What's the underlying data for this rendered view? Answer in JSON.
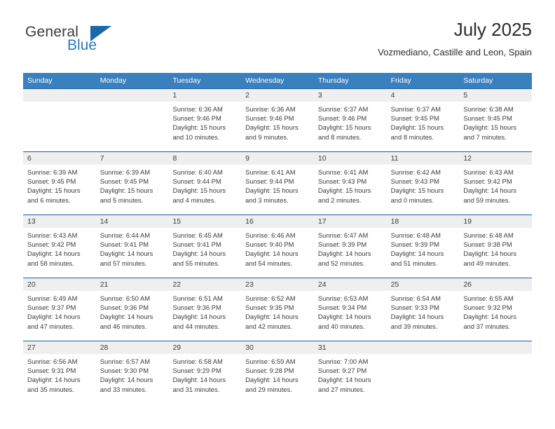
{
  "brand": {
    "name_part1": "General",
    "name_part2": "Blue",
    "triangle_color": "#1769a8",
    "blue_color": "#2a7ac0"
  },
  "header": {
    "month_title": "July 2025",
    "location": "Vozmediano, Castille and Leon, Spain",
    "header_bg": "#3a7fbe",
    "row_divider": "#1c5f9e",
    "daynum_bg": "#efeff0"
  },
  "weekdays": [
    "Sunday",
    "Monday",
    "Tuesday",
    "Wednesday",
    "Thursday",
    "Friday",
    "Saturday"
  ],
  "weeks": [
    [
      {
        "day": "",
        "sunrise": "",
        "sunset": "",
        "daylight1": "",
        "daylight2": ""
      },
      {
        "day": "",
        "sunrise": "",
        "sunset": "",
        "daylight1": "",
        "daylight2": ""
      },
      {
        "day": "1",
        "sunrise": "Sunrise: 6:36 AM",
        "sunset": "Sunset: 9:46 PM",
        "daylight1": "Daylight: 15 hours",
        "daylight2": "and 10 minutes."
      },
      {
        "day": "2",
        "sunrise": "Sunrise: 6:36 AM",
        "sunset": "Sunset: 9:46 PM",
        "daylight1": "Daylight: 15 hours",
        "daylight2": "and 9 minutes."
      },
      {
        "day": "3",
        "sunrise": "Sunrise: 6:37 AM",
        "sunset": "Sunset: 9:46 PM",
        "daylight1": "Daylight: 15 hours",
        "daylight2": "and 8 minutes."
      },
      {
        "day": "4",
        "sunrise": "Sunrise: 6:37 AM",
        "sunset": "Sunset: 9:45 PM",
        "daylight1": "Daylight: 15 hours",
        "daylight2": "and 8 minutes."
      },
      {
        "day": "5",
        "sunrise": "Sunrise: 6:38 AM",
        "sunset": "Sunset: 9:45 PM",
        "daylight1": "Daylight: 15 hours",
        "daylight2": "and 7 minutes."
      }
    ],
    [
      {
        "day": "6",
        "sunrise": "Sunrise: 6:39 AM",
        "sunset": "Sunset: 9:45 PM",
        "daylight1": "Daylight: 15 hours",
        "daylight2": "and 6 minutes."
      },
      {
        "day": "7",
        "sunrise": "Sunrise: 6:39 AM",
        "sunset": "Sunset: 9:45 PM",
        "daylight1": "Daylight: 15 hours",
        "daylight2": "and 5 minutes."
      },
      {
        "day": "8",
        "sunrise": "Sunrise: 6:40 AM",
        "sunset": "Sunset: 9:44 PM",
        "daylight1": "Daylight: 15 hours",
        "daylight2": "and 4 minutes."
      },
      {
        "day": "9",
        "sunrise": "Sunrise: 6:41 AM",
        "sunset": "Sunset: 9:44 PM",
        "daylight1": "Daylight: 15 hours",
        "daylight2": "and 3 minutes."
      },
      {
        "day": "10",
        "sunrise": "Sunrise: 6:41 AM",
        "sunset": "Sunset: 9:43 PM",
        "daylight1": "Daylight: 15 hours",
        "daylight2": "and 2 minutes."
      },
      {
        "day": "11",
        "sunrise": "Sunrise: 6:42 AM",
        "sunset": "Sunset: 9:43 PM",
        "daylight1": "Daylight: 15 hours",
        "daylight2": "and 0 minutes."
      },
      {
        "day": "12",
        "sunrise": "Sunrise: 6:43 AM",
        "sunset": "Sunset: 9:42 PM",
        "daylight1": "Daylight: 14 hours",
        "daylight2": "and 59 minutes."
      }
    ],
    [
      {
        "day": "13",
        "sunrise": "Sunrise: 6:43 AM",
        "sunset": "Sunset: 9:42 PM",
        "daylight1": "Daylight: 14 hours",
        "daylight2": "and 58 minutes."
      },
      {
        "day": "14",
        "sunrise": "Sunrise: 6:44 AM",
        "sunset": "Sunset: 9:41 PM",
        "daylight1": "Daylight: 14 hours",
        "daylight2": "and 57 minutes."
      },
      {
        "day": "15",
        "sunrise": "Sunrise: 6:45 AM",
        "sunset": "Sunset: 9:41 PM",
        "daylight1": "Daylight: 14 hours",
        "daylight2": "and 55 minutes."
      },
      {
        "day": "16",
        "sunrise": "Sunrise: 6:46 AM",
        "sunset": "Sunset: 9:40 PM",
        "daylight1": "Daylight: 14 hours",
        "daylight2": "and 54 minutes."
      },
      {
        "day": "17",
        "sunrise": "Sunrise: 6:47 AM",
        "sunset": "Sunset: 9:39 PM",
        "daylight1": "Daylight: 14 hours",
        "daylight2": "and 52 minutes."
      },
      {
        "day": "18",
        "sunrise": "Sunrise: 6:48 AM",
        "sunset": "Sunset: 9:39 PM",
        "daylight1": "Daylight: 14 hours",
        "daylight2": "and 51 minutes."
      },
      {
        "day": "19",
        "sunrise": "Sunrise: 6:48 AM",
        "sunset": "Sunset: 9:38 PM",
        "daylight1": "Daylight: 14 hours",
        "daylight2": "and 49 minutes."
      }
    ],
    [
      {
        "day": "20",
        "sunrise": "Sunrise: 6:49 AM",
        "sunset": "Sunset: 9:37 PM",
        "daylight1": "Daylight: 14 hours",
        "daylight2": "and 47 minutes."
      },
      {
        "day": "21",
        "sunrise": "Sunrise: 6:50 AM",
        "sunset": "Sunset: 9:36 PM",
        "daylight1": "Daylight: 14 hours",
        "daylight2": "and 46 minutes."
      },
      {
        "day": "22",
        "sunrise": "Sunrise: 6:51 AM",
        "sunset": "Sunset: 9:36 PM",
        "daylight1": "Daylight: 14 hours",
        "daylight2": "and 44 minutes."
      },
      {
        "day": "23",
        "sunrise": "Sunrise: 6:52 AM",
        "sunset": "Sunset: 9:35 PM",
        "daylight1": "Daylight: 14 hours",
        "daylight2": "and 42 minutes."
      },
      {
        "day": "24",
        "sunrise": "Sunrise: 6:53 AM",
        "sunset": "Sunset: 9:34 PM",
        "daylight1": "Daylight: 14 hours",
        "daylight2": "and 40 minutes."
      },
      {
        "day": "25",
        "sunrise": "Sunrise: 6:54 AM",
        "sunset": "Sunset: 9:33 PM",
        "daylight1": "Daylight: 14 hours",
        "daylight2": "and 39 minutes."
      },
      {
        "day": "26",
        "sunrise": "Sunrise: 6:55 AM",
        "sunset": "Sunset: 9:32 PM",
        "daylight1": "Daylight: 14 hours",
        "daylight2": "and 37 minutes."
      }
    ],
    [
      {
        "day": "27",
        "sunrise": "Sunrise: 6:56 AM",
        "sunset": "Sunset: 9:31 PM",
        "daylight1": "Daylight: 14 hours",
        "daylight2": "and 35 minutes."
      },
      {
        "day": "28",
        "sunrise": "Sunrise: 6:57 AM",
        "sunset": "Sunset: 9:30 PM",
        "daylight1": "Daylight: 14 hours",
        "daylight2": "and 33 minutes."
      },
      {
        "day": "29",
        "sunrise": "Sunrise: 6:58 AM",
        "sunset": "Sunset: 9:29 PM",
        "daylight1": "Daylight: 14 hours",
        "daylight2": "and 31 minutes."
      },
      {
        "day": "30",
        "sunrise": "Sunrise: 6:59 AM",
        "sunset": "Sunset: 9:28 PM",
        "daylight1": "Daylight: 14 hours",
        "daylight2": "and 29 minutes."
      },
      {
        "day": "31",
        "sunrise": "Sunrise: 7:00 AM",
        "sunset": "Sunset: 9:27 PM",
        "daylight1": "Daylight: 14 hours",
        "daylight2": "and 27 minutes."
      },
      {
        "day": "",
        "sunrise": "",
        "sunset": "",
        "daylight1": "",
        "daylight2": ""
      },
      {
        "day": "",
        "sunrise": "",
        "sunset": "",
        "daylight1": "",
        "daylight2": ""
      }
    ]
  ]
}
